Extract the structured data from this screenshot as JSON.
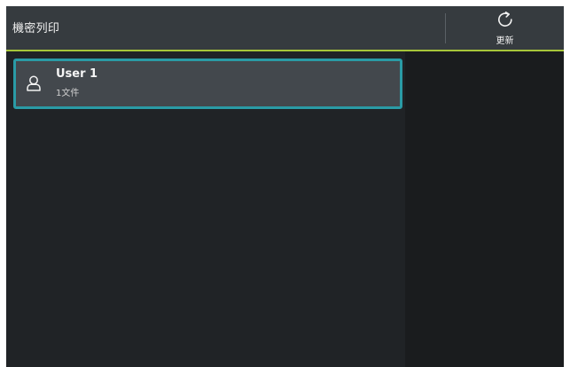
{
  "header": {
    "title": "機密列印",
    "refresh_label": "更新"
  },
  "users": [
    {
      "name": "User 1",
      "file_count": "1文件"
    }
  ],
  "icons": {
    "refresh": "refresh-icon",
    "user": "user-icon"
  },
  "colors": {
    "header_bg": "#363b3f",
    "accent_line": "#a7c63a",
    "selection_border": "#2a9ba6",
    "item_bg": "#43484d"
  }
}
